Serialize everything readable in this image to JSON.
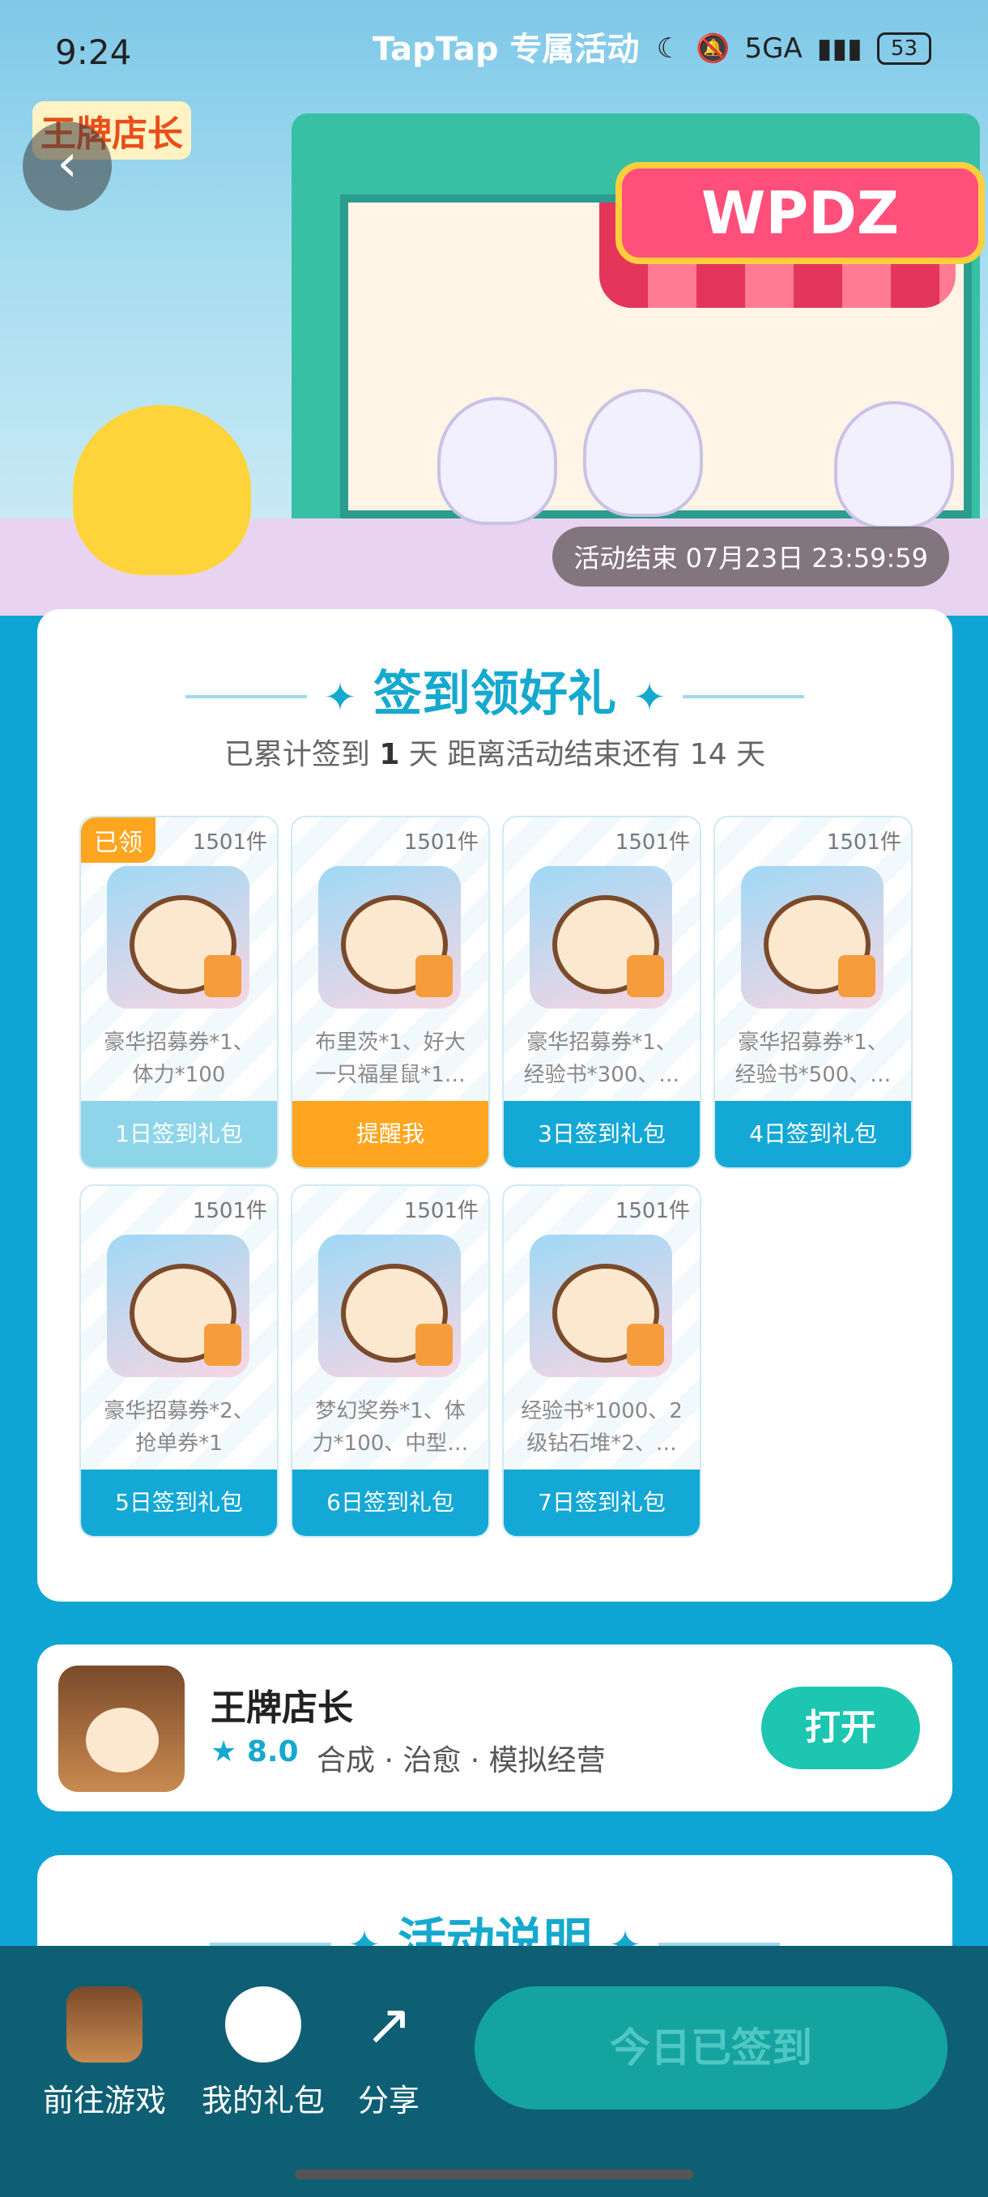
{
  "status_bar": {
    "time": "9:24",
    "center_title": "TapTap 专属活动",
    "network": "5GA",
    "battery": "53"
  },
  "banner": {
    "game_logo": "王牌店长",
    "shop_sign": "WPDZ",
    "activity_end": "活动结束 07月23日 23:59:59"
  },
  "signin": {
    "title": "签到领好礼",
    "subtitle_prefix": "已累计签到",
    "days_signed": "1",
    "subtitle_mid": "天  距离活动结束还有",
    "days_left": "14",
    "subtitle_suffix": "天",
    "gifts": [
      {
        "qty": "1501件",
        "desc": "豪华招募券*1、\n体力*100",
        "button": "1日签到礼包",
        "state": "claimed",
        "badge": "已领"
      },
      {
        "qty": "1501件",
        "desc": "布里茨*1、好大\n一只福星鼠*1…",
        "button": "提醒我",
        "state": "remind"
      },
      {
        "qty": "1501件",
        "desc": "豪华招募券*1、\n经验书*300、…",
        "button": "3日签到礼包",
        "state": "normal"
      },
      {
        "qty": "1501件",
        "desc": "豪华招募券*1、\n经验书*500、…",
        "button": "4日签到礼包",
        "state": "normal"
      },
      {
        "qty": "1501件",
        "desc": "豪华招募券*2、\n抢单券*1",
        "button": "5日签到礼包",
        "state": "normal"
      },
      {
        "qty": "1501件",
        "desc": "梦幻奖券*1、体\n力*100、中型…",
        "button": "6日签到礼包",
        "state": "normal"
      },
      {
        "qty": "1501件",
        "desc": "经验书*1000、2\n级钻石堆*2、…",
        "button": "7日签到礼包",
        "state": "normal"
      }
    ]
  },
  "app": {
    "name": "王牌店长",
    "rating": "8.0",
    "tags": "合成 · 治愈 · 模拟经营",
    "open_label": "打开"
  },
  "description": {
    "title": "活动说明"
  },
  "bottom_bar": {
    "go_game": "前往游戏",
    "my_gifts": "我的礼包",
    "share": "分享",
    "checkin": "今日已签到"
  },
  "colors": {
    "accent": "#16a9cf",
    "background": "#0ea5d4",
    "remind": "#ffa51f",
    "open": "#1dc6b0"
  }
}
